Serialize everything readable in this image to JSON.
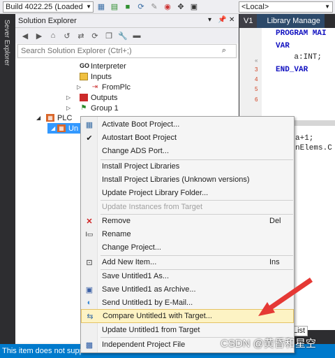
{
  "toolbar": {
    "build_config": "Build 4022.25 (Loaded",
    "target": "<Local>"
  },
  "side_strip": {
    "label": "Sever Explorer"
  },
  "solution_explorer": {
    "title": "Solution Explorer",
    "search_placeholder": "Search Solution Explorer (Ctrl+;)",
    "tree": [
      {
        "label": "Interpreter",
        "icon": "interpreter-icon"
      },
      {
        "label": "Inputs",
        "icon": "inputs-icon"
      },
      {
        "label": "FromPlc",
        "icon": "fromplc-icon"
      },
      {
        "label": "Outputs",
        "icon": "outputs-icon"
      },
      {
        "label": "Group 1",
        "icon": "group-icon"
      },
      {
        "label": "PLC",
        "icon": "plc-icon"
      },
      {
        "label": "Un",
        "icon": "project-icon"
      }
    ]
  },
  "editor": {
    "tabs": [
      "V1",
      "Library Manage"
    ],
    "code_lines": [
      "PROGRAM MAI",
      "VAR",
      "    a:INT;",
      "END_VAR"
    ],
    "code_bottom": [
      "a+1;",
      "nElems.C"
    ],
    "list_tab": "List"
  },
  "context_menu": {
    "items": [
      {
        "label": "Activate Boot Project...",
        "icon": "boot-icon",
        "shortcut": "",
        "disabled": false
      },
      {
        "label": "Autostart Boot Project",
        "icon": "check-icon",
        "shortcut": "",
        "disabled": false
      },
      {
        "label": "Change ADS Port...",
        "icon": "",
        "shortcut": "",
        "disabled": false
      },
      {
        "label": "Install Project Libraries",
        "icon": "",
        "shortcut": "",
        "disabled": false
      },
      {
        "label": "Install Project Libraries (Unknown versions)",
        "icon": "",
        "shortcut": "",
        "disabled": false
      },
      {
        "label": "Update Project Library Folder...",
        "icon": "",
        "shortcut": "",
        "disabled": false
      },
      {
        "label": "Update Instances from Target",
        "icon": "",
        "shortcut": "",
        "disabled": true
      },
      {
        "label": "Remove",
        "icon": "remove-icon",
        "shortcut": "Del",
        "disabled": false
      },
      {
        "label": "Rename",
        "icon": "rename-icon",
        "shortcut": "",
        "disabled": false
      },
      {
        "label": "Change Project...",
        "icon": "",
        "shortcut": "",
        "disabled": false
      },
      {
        "label": "Add New Item...",
        "icon": "add-item-icon",
        "shortcut": "Ins",
        "disabled": false
      },
      {
        "label": "Save Untitled1 As...",
        "icon": "",
        "shortcut": "",
        "disabled": false
      },
      {
        "label": "Save Untitled1 as Archive...",
        "icon": "archive-icon",
        "shortcut": "",
        "disabled": false
      },
      {
        "label": "Send Untitled1 by E-Mail...",
        "icon": "email-icon",
        "shortcut": "",
        "disabled": false
      },
      {
        "label": "Compare Untitled1 with Target...",
        "icon": "compare-icon",
        "shortcut": "",
        "disabled": false
      },
      {
        "label": "Update Untitled1 from Target",
        "icon": "",
        "shortcut": "",
        "disabled": false
      },
      {
        "label": "Independent Project File",
        "icon": "save-icon",
        "shortcut": "",
        "disabled": false
      }
    ]
  },
  "status_bar": {
    "text": "This item does not supp"
  },
  "watermark": "CSDN @黄昏和星空",
  "colors": {
    "accent": "#007acc",
    "highlight": "#fdf3c4",
    "selection": "#3399ff",
    "arrow": "#e53935"
  }
}
